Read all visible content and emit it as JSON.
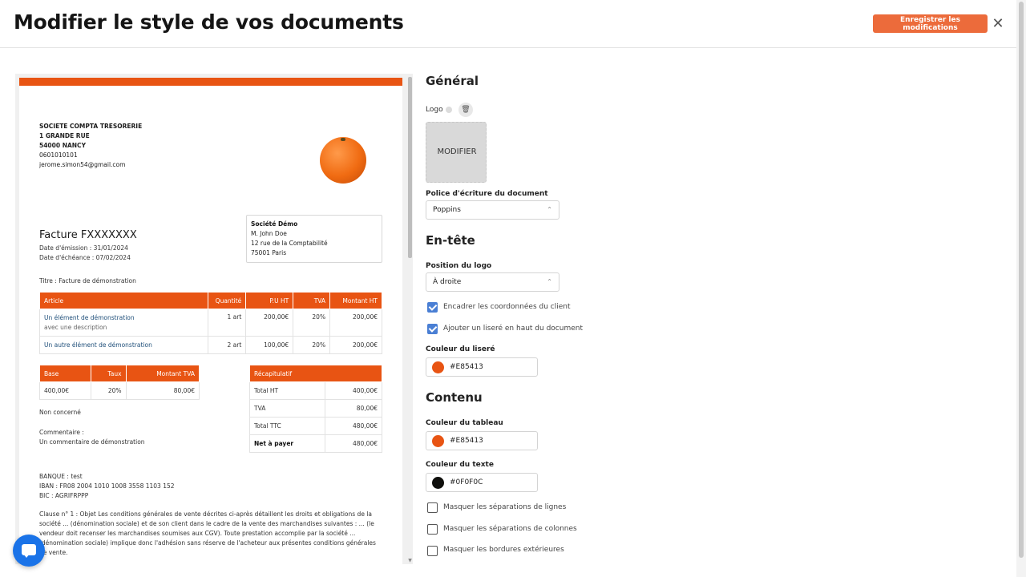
{
  "header": {
    "title": "Modifier le style de vos documents",
    "save_label": "Enregistrer les modifications",
    "close_glyph": "✕"
  },
  "document": {
    "band_color": "#E85413",
    "company": {
      "name": "SOCIETE COMPTA TRESORERIE",
      "address1": "1 GRANDE RUE",
      "address2": "54000 NANCY",
      "phone": "0601010101",
      "email": "jerome.simon54@gmail.com"
    },
    "client": {
      "name": "Société Démo",
      "contact": "M. John Doe",
      "street": "12 rue de la Comptabilité",
      "city": "75001 Paris"
    },
    "invoice": {
      "title": "Facture FXXXXXXX",
      "issue_date": "Date d'émission : 31/01/2024",
      "due_date": "Date d'échéance : 07/02/2024",
      "subject": "Titre : Facture de démonstration"
    },
    "items_table": {
      "headers": [
        "Article",
        "Quantité",
        "P.U HT",
        "TVA",
        "Montant HT"
      ],
      "rows": [
        {
          "article": "Un élément de démonstration",
          "description": "avec une description",
          "qty": "1 art",
          "pu": "200,00€",
          "tva": "20%",
          "amount": "200,00€"
        },
        {
          "article": "Un autre élément de démonstration",
          "description": "",
          "qty": "2 art",
          "pu": "100,00€",
          "tva": "20%",
          "amount": "200,00€"
        }
      ]
    },
    "vat_table": {
      "headers": [
        "Base",
        "Taux",
        "Montant TVA"
      ],
      "rows": [
        {
          "base": "400,00€",
          "rate": "20%",
          "amount": "80,00€"
        }
      ]
    },
    "summary_table": {
      "header": "Récapitulatif",
      "rows": [
        {
          "label": "Total HT",
          "value": "400,00€"
        },
        {
          "label": "TVA",
          "value": "80,00€"
        },
        {
          "label": "Total TTC",
          "value": "480,00€"
        },
        {
          "label": "Net à payer",
          "value": "480,00€"
        }
      ]
    },
    "vat_note": "Non concerné",
    "comment_label": "Commentaire :",
    "comment": "Un commentaire de démonstration",
    "bank": {
      "name": "BANQUE : test",
      "iban": "IBAN : FR08 2004 1010 1008 3558 1103 152",
      "bic": "BIC : AGRIFRPPP"
    },
    "clause": "Clause n° 1 : Objet Les conditions générales de vente décrites ci-après détaillent les droits et obligations de la société ... (dénomination sociale) et de son client dans le cadre de la vente des marchandises suivantes : ... (le vendeur doit recenser les marchandises soumises aux CGV). Toute prestation accomplie par la société ... (dénomination sociale) implique donc l'adhésion sans réserve de l'acheteur aux présentes conditions générales de vente."
  },
  "settings": {
    "general": {
      "title": "Général",
      "logo_label": "Logo",
      "logo_button": "MODIFIER",
      "font_label": "Police d'écriture du document",
      "font_value": "Poppins"
    },
    "header_section": {
      "title": "En-tête",
      "logo_position_label": "Position du logo",
      "logo_position_value": "À droite",
      "frame_client_label": "Encadrer les coordonnées du client",
      "frame_client_checked": true,
      "add_band_label": "Ajouter un liseré en haut du document",
      "add_band_checked": true,
      "band_color_label": "Couleur du liseré",
      "band_color_value": "#E85413"
    },
    "content": {
      "title": "Contenu",
      "table_color_label": "Couleur du tableau",
      "table_color_value": "#E85413",
      "text_color_label": "Couleur du texte",
      "text_color_value": "#0F0F0C",
      "hide_row_sep_label": "Masquer les séparations de lignes",
      "hide_row_sep_checked": false,
      "hide_col_sep_label": "Masquer les séparations de colonnes",
      "hide_col_sep_checked": false,
      "hide_borders_label": "Masquer les bordures extérieures",
      "hide_borders_checked": false
    }
  },
  "icons": {
    "trash": "🗑",
    "chevron": "⌃⌄",
    "chat": "chat-bubble-icon"
  }
}
